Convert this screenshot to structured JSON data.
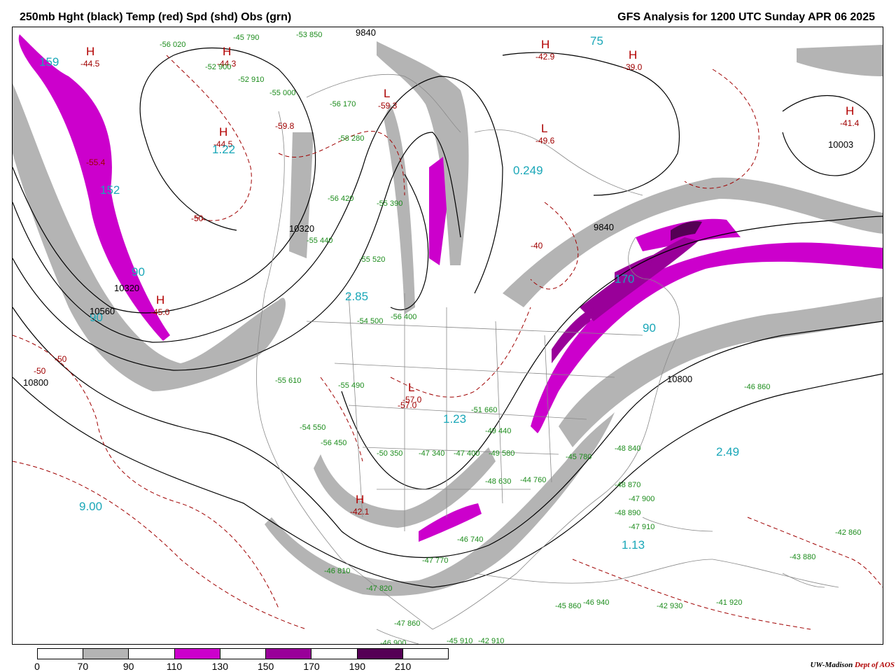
{
  "header": {
    "title_left": "250mb Hght (black) Temp (red) Spd (shd) Obs (grn)",
    "title_right": "GFS Analysis for 1200 UTC Sunday  APR 06 2025"
  },
  "legend": {
    "colors": [
      "#ffffff",
      "#b4b4b4",
      "#ffffff",
      "#cc00cc",
      "#ffffff",
      "#990099",
      "#ffffff",
      "#550055",
      "#ffffff"
    ],
    "ticks": [
      "0",
      "70",
      "90",
      "110",
      "130",
      "150",
      "170",
      "190",
      "210"
    ]
  },
  "credit": {
    "main": "UW-Madison",
    "accent": "Dept of AOS"
  },
  "map": {
    "pressure_centers": [
      {
        "kind": "H",
        "value": "-44.5"
      },
      {
        "kind": "H",
        "value": "-44.3"
      },
      {
        "kind": "H",
        "value": "-44.5"
      },
      {
        "kind": "H",
        "value": "-42.9"
      },
      {
        "kind": "H",
        "value": "-39.0"
      },
      {
        "kind": "H",
        "value": "-41.4"
      },
      {
        "kind": "L",
        "value": "-59.3"
      },
      {
        "kind": "L",
        "value": "-49.6"
      },
      {
        "kind": "L",
        "value": "-57.0"
      },
      {
        "kind": "H",
        "value": "-42.1"
      },
      {
        "kind": "H",
        "value": "-45.0"
      }
    ],
    "speed_labels": [
      "159",
      "152",
      "90",
      "90",
      "1.22",
      "0.249",
      "2.85",
      "1.23",
      "9.00",
      "2.49",
      "170",
      "90",
      "75",
      "1.13"
    ],
    "height_labels": [
      "9840",
      "10320",
      "10560",
      "10800",
      "10800",
      "10320",
      "10003",
      "9840"
    ],
    "temp_labels": [
      "-50",
      "-50",
      "-50",
      "-57.0",
      "-59.8",
      "-55.4",
      "-40"
    ],
    "obs_samples": [
      "-56 020",
      "-45 790",
      "-53 850",
      "-52 900",
      "-52 910",
      "-55 000",
      "-56 170",
      "-58 280",
      "-56 420",
      "-55 390",
      "-55 440",
      "-55 520",
      "-54 500",
      "-56 400",
      "-55 610",
      "-55 490",
      "-54 550",
      "-56 450",
      "-50 350",
      "-47 340",
      "-47 400",
      "-49 440",
      "-49 580",
      "-48 630",
      "-44 760",
      "-45 780",
      "-48 840",
      "-48 870",
      "-47 900",
      "-48 890",
      "-47 910",
      "-46 860",
      "-43 880",
      "-42 860",
      "-45 860",
      "-46 940",
      "-42 930",
      "-41 920",
      "-47 860",
      "-46 900",
      "-45 910",
      "-42 910",
      "-47 820",
      "-46 810",
      "-47 770",
      "-46 740",
      "-51 660"
    ]
  }
}
